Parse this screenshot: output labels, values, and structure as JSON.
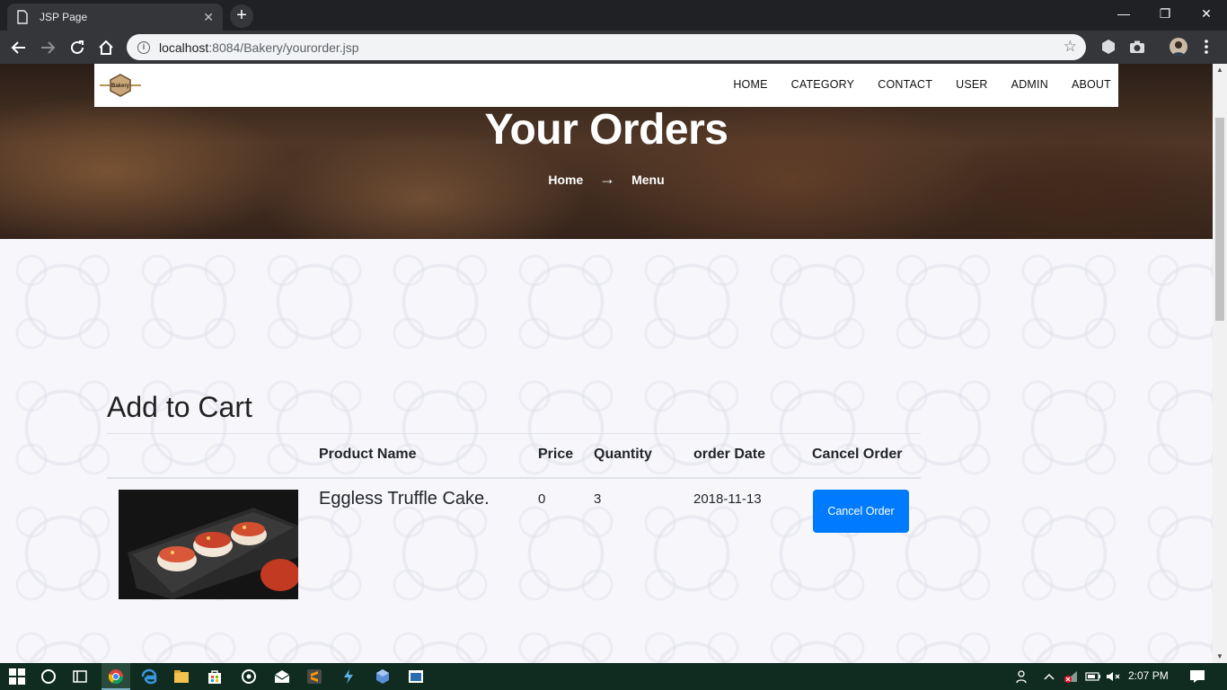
{
  "browser": {
    "tab_title": "JSP Page",
    "tab_close": "✕",
    "new_tab": "+",
    "url_host": "localhost",
    "url_path": ":8084/Bakery/yourorder.jsp",
    "window_minimize": "—",
    "window_restore": "❐",
    "window_close": "✕"
  },
  "navbar": {
    "logo_text": "Bakery",
    "links": [
      "HOME",
      "CATEGORY",
      "CONTACT",
      "USER",
      "ADMIN",
      "ABOUT"
    ]
  },
  "hero": {
    "title": "Your Orders",
    "breadcrumb_home": "Home",
    "breadcrumb_arrow": "→",
    "breadcrumb_current": "Menu"
  },
  "cart": {
    "heading": "Add to Cart",
    "columns": {
      "product_name": "Product Name",
      "price": "Price",
      "quantity": "Quantity",
      "order_date": "order Date",
      "cancel_order": "Cancel Order"
    },
    "rows": [
      {
        "product_name": "Eggless Truffle Cake.",
        "price": "0",
        "quantity": "3",
        "order_date": "2018-11-13",
        "cancel_label": "Cancel Order"
      }
    ]
  },
  "taskbar": {
    "clock": "2:07 PM",
    "icons": [
      "windows-start-icon",
      "cortana-icon",
      "task-view-icon",
      "chrome-icon",
      "edge-icon",
      "file-explorer-icon",
      "store-icon",
      "media-icon",
      "mail-icon",
      "sublime-icon",
      "flash-icon",
      "virtualbox-icon",
      "app-icon"
    ]
  },
  "colors": {
    "primary_button": "#007bff",
    "browser_frame": "#202124",
    "taskbar": "#102c21"
  }
}
